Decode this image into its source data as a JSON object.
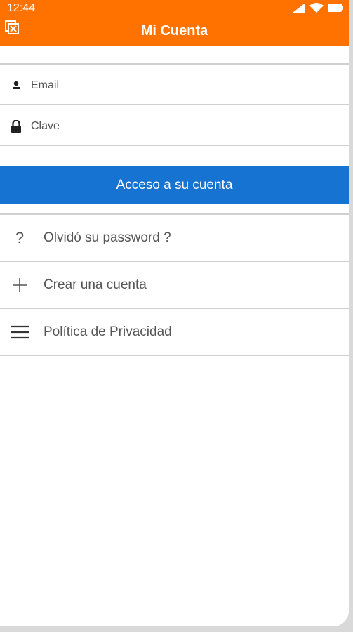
{
  "status_bar": {
    "time": "12:44"
  },
  "app_bar": {
    "title": "Mi Cuenta",
    "close_icon": "close-window-icon"
  },
  "form": {
    "email_placeholder": "Email",
    "email_icon": "user-icon",
    "password_placeholder": "Clave",
    "password_icon": "lock-icon",
    "login_label": "Acceso a su cuenta"
  },
  "menu": {
    "items": [
      {
        "icon": "question-icon",
        "glyph": "?",
        "label": "Olvidó su password ?"
      },
      {
        "icon": "plus-icon",
        "glyph": "+",
        "label": "Crear una cuenta"
      },
      {
        "icon": "menu-icon",
        "glyph": "≡",
        "label": "Política de Privacidad"
      }
    ]
  },
  "colors": {
    "app_bar": "#ff7200",
    "primary_button": "#1673d1",
    "divider": "#d0d0d0"
  }
}
